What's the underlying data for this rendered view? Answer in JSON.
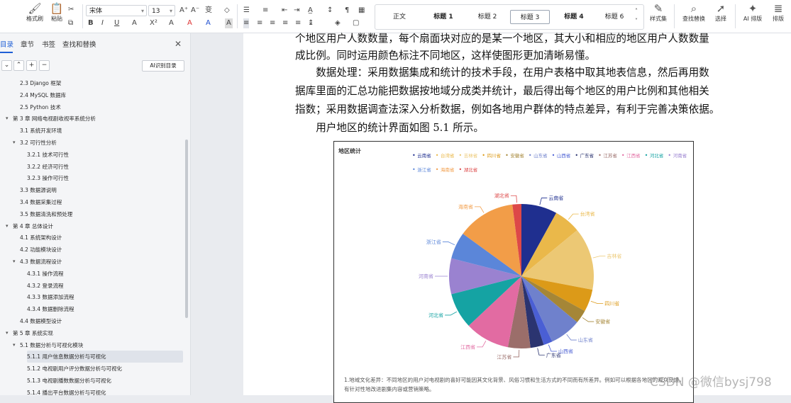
{
  "ribbon": {
    "format_painter": "格式刷",
    "paste": "粘贴",
    "font_name": "宋体",
    "font_size": "13",
    "styles": [
      "正文",
      "标题 1",
      "标题 2",
      "标题 3",
      "标题 4",
      "标题 6"
    ],
    "selected_style": "标题 3",
    "style_set": "样式集",
    "find_replace": "查找替换",
    "select": "选择",
    "ai_layout": "AI 排版",
    "layout": "排版"
  },
  "sidebar": {
    "tabs": [
      "目录",
      "章节",
      "书签",
      "查找和替换"
    ],
    "ai_toc_button": "AI识别目录",
    "toc": [
      {
        "label": "2.3 Django 框架",
        "level": 2,
        "arrow": ""
      },
      {
        "label": "2.4 MySQL 数据库",
        "level": 2,
        "arrow": ""
      },
      {
        "label": "2.5 Python 技术",
        "level": 2,
        "arrow": ""
      },
      {
        "label": "第 3 章  网络电视剧收视率系统分析",
        "level": 1,
        "arrow": "▾"
      },
      {
        "label": "3.1 系统开发环境",
        "level": 2,
        "arrow": ""
      },
      {
        "label": "3.2 可行性分析",
        "level": 2,
        "arrow": "▾"
      },
      {
        "label": "3.2.1 技术可行性",
        "level": 3,
        "arrow": ""
      },
      {
        "label": "3.2.2 经济可行性",
        "level": 3,
        "arrow": ""
      },
      {
        "label": "3.2.3 操作可行性",
        "level": 3,
        "arrow": ""
      },
      {
        "label": "3.3 数据源说明",
        "level": 2,
        "arrow": ""
      },
      {
        "label": "3.4 数据采集过程",
        "level": 2,
        "arrow": ""
      },
      {
        "label": "3.5 数据清洗和预处理",
        "level": 2,
        "arrow": ""
      },
      {
        "label": "第 4 章  总体设计",
        "level": 1,
        "arrow": "▾"
      },
      {
        "label": "4.1 系统架构设计",
        "level": 2,
        "arrow": ""
      },
      {
        "label": "4.2 功能模块设计",
        "level": 2,
        "arrow": ""
      },
      {
        "label": "4.3 数据流程设计",
        "level": 2,
        "arrow": "▾"
      },
      {
        "label": "4.3.1 操作流程",
        "level": 3,
        "arrow": ""
      },
      {
        "label": "4.3.2 登录流程",
        "level": 3,
        "arrow": ""
      },
      {
        "label": "4.3.3 数据添加流程",
        "level": 3,
        "arrow": ""
      },
      {
        "label": "4.3.4 数据删除流程",
        "level": 3,
        "arrow": ""
      },
      {
        "label": "4.4 数据模型设计",
        "level": 2,
        "arrow": ""
      },
      {
        "label": "第 5 章  系统实现",
        "level": 1,
        "arrow": "▾"
      },
      {
        "label": "5.1 数据分析与可视化模块",
        "level": 2,
        "arrow": "▾"
      },
      {
        "label": "5.1.1 用户信息数据分析与可视化",
        "level": 3,
        "arrow": "",
        "highlight": true
      },
      {
        "label": "5.1.2 电视剧用户评分数据分析与可视化",
        "level": 3,
        "arrow": ""
      },
      {
        "label": "5.1.3 电视剧播数数据分析与可视化",
        "level": 3,
        "arrow": ""
      },
      {
        "label": "5.1.4 播出平台数据分析与可视化",
        "level": 3,
        "arrow": ""
      }
    ]
  },
  "document": {
    "paragraphs": [
      "个地区用户人数数量，每个扇面块对应的是某一个地区，其大小和相应的地区用户人数数量",
      "成比例。同时运用颜色标注不同地区，这样使图形更加清晰易懂。",
      "　　数据处理：采用数据集成和统计的技术手段，在用户表格中取其地表信息，然后再用数",
      "据库里面的汇总功能把数据按地域分成类并统计，最后得出每个地区的用户比例和其他相关",
      "指数；采用数据调查法深入分析数据，例如各地用户群体的特点差异，有利于完善决策依据。",
      "　　用户地区的统计界面如图 5.1 所示。"
    ],
    "figure_note": "1.地域文化差异：不同地区的用户对电视剧的喜好可能因其文化背景、风俗习惯和生活方式的不同而有所差异。例如可以根据各地区的观众反馈，有针对性地改进剧集内容或营销策略。"
  },
  "chart_data": {
    "type": "pie",
    "title": "地区统计",
    "legend_placement": "top",
    "series": [
      {
        "name": "云南省",
        "value": 8,
        "color": "#1f2f8f"
      },
      {
        "name": "台湾省",
        "value": 6,
        "color": "#eab84a"
      },
      {
        "name": "吉林省",
        "value": 14,
        "color": "#ecc874"
      },
      {
        "name": "四川省",
        "value": 5,
        "color": "#dc9a18"
      },
      {
        "name": "安徽省",
        "value": 3,
        "color": "#a58637"
      },
      {
        "name": "山东省",
        "value": 7,
        "color": "#6f81cc"
      },
      {
        "name": "山西省",
        "value": 2,
        "color": "#4a5fd4"
      },
      {
        "name": "广东省",
        "value": 3,
        "color": "#2b3470"
      },
      {
        "name": "江苏省",
        "value": 5,
        "color": "#9b6e6a"
      },
      {
        "name": "江西省",
        "value": 10,
        "color": "#e26ba2"
      },
      {
        "name": "河北省",
        "value": 8,
        "color": "#15a3a3"
      },
      {
        "name": "河南省",
        "value": 8,
        "color": "#9a82d0"
      },
      {
        "name": "浙江省",
        "value": 6,
        "color": "#5b86d9"
      },
      {
        "name": "海南省",
        "value": 13,
        "color": "#f29d48"
      },
      {
        "name": "湖北省",
        "value": 2,
        "color": "#dd4848"
      }
    ]
  },
  "watermark": "CSDN @微信bysj798"
}
